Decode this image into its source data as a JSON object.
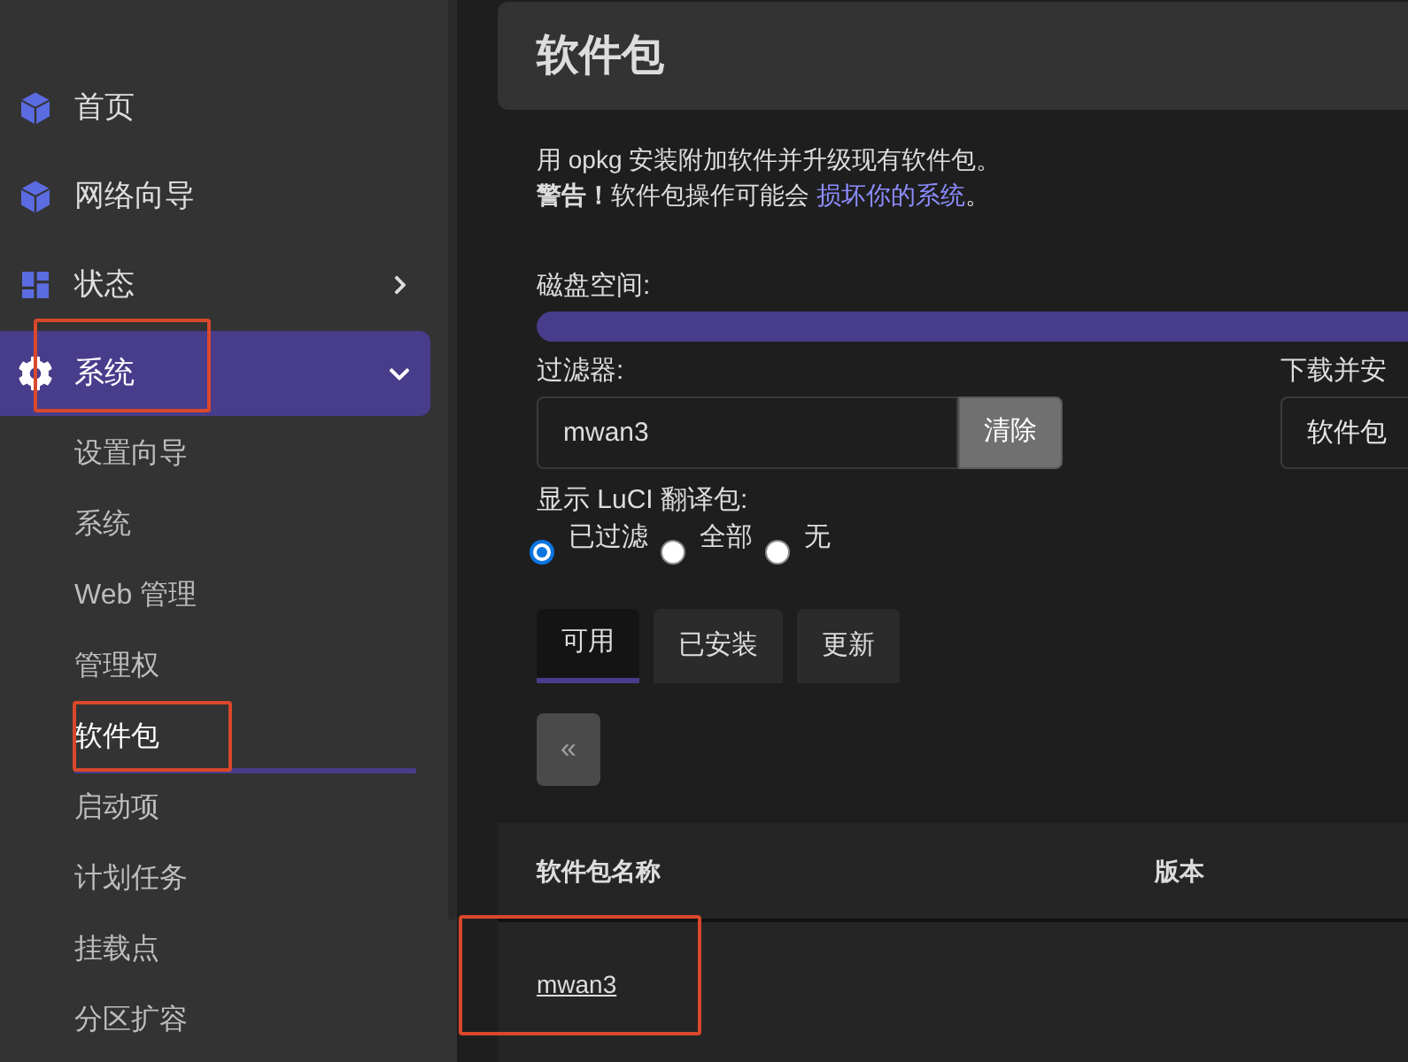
{
  "sidebar": {
    "items": [
      {
        "label": "首页",
        "kind": "link",
        "selected": false,
        "highlighted": false
      },
      {
        "label": "网络向导",
        "kind": "link",
        "selected": false,
        "highlighted": false
      },
      {
        "label": "状态",
        "kind": "menu",
        "expanded": false,
        "selected": false,
        "highlighted": false
      },
      {
        "label": "系统",
        "kind": "menu",
        "expanded": true,
        "selected": true,
        "highlighted": true,
        "children": [
          {
            "label": "设置向导",
            "selected": false,
            "highlighted": false
          },
          {
            "label": "系统",
            "selected": false,
            "highlighted": false
          },
          {
            "label": "Web 管理",
            "selected": false,
            "highlighted": false
          },
          {
            "label": "管理权",
            "selected": false,
            "highlighted": false
          },
          {
            "label": "软件包",
            "selected": true,
            "highlighted": true
          },
          {
            "label": "启动项",
            "selected": false,
            "highlighted": false
          },
          {
            "label": "计划任务",
            "selected": false,
            "highlighted": false
          },
          {
            "label": "挂载点",
            "selected": false,
            "highlighted": false
          },
          {
            "label": "分区扩容",
            "selected": false,
            "highlighted": false
          }
        ]
      }
    ]
  },
  "page": {
    "title": "软件包",
    "description": "用 opkg 安装附加软件并升级现有软件包。",
    "warning": {
      "text": "**警告！**软件包操作可能会",
      "link": "损坏你的系统",
      "end": "。"
    }
  },
  "disk": {
    "label": "磁盘空间:",
    "level": 1
  },
  "filter": {
    "label": "过滤器:",
    "value": "mwan3",
    "button": "清除"
  },
  "download": {
    "label": "下载并安",
    "placeholder": "软件包"
  },
  "translations": {
    "label": "显示 LuCI 翻译包:",
    "options": [
      {
        "label": "已过滤",
        "selected": true
      },
      {
        "label": "全部",
        "selected": false
      },
      {
        "label": "无",
        "selected": false
      }
    ]
  },
  "tabs": [
    {
      "label": "可用",
      "selected": true
    },
    {
      "label": "已安装",
      "selected": false
    },
    {
      "label": "更新",
      "selected": false
    }
  ],
  "pager": {
    "label": "«",
    "disabled": true
  },
  "table": {
    "columns": [
      "软件包名称",
      "版本"
    ],
    "rows": [
      {
        "name": "mwan3",
        "highlighted": true
      }
    ]
  }
}
